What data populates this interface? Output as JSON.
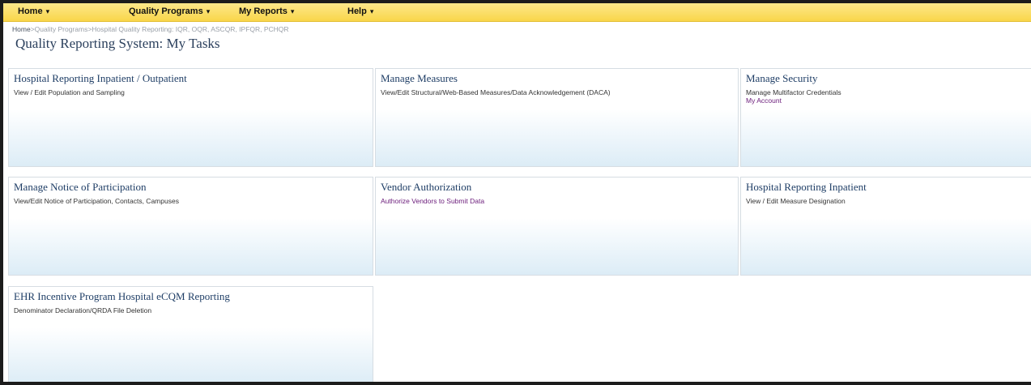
{
  "nav": {
    "items": [
      {
        "label": "Home"
      },
      {
        "label": "Quality Programs"
      },
      {
        "label": "My Reports"
      },
      {
        "label": "Help"
      }
    ],
    "caret_icon": "caret-down-icon"
  },
  "breadcrumb": {
    "home": "Home",
    "separator": ">",
    "programs": "Quality Programs",
    "current": "Hospital Quality Reporting: IQR, OQR, ASCQR, IPFQR, PCHQR"
  },
  "page_title": "Quality Reporting System: My Tasks",
  "tiles": [
    {
      "title": "Hospital Reporting Inpatient / Outpatient",
      "links": [
        {
          "label": "View / Edit Population and Sampling"
        }
      ]
    },
    {
      "title": "Manage Measures",
      "links": [
        {
          "label": "View/Edit Structural/Web-Based Measures/Data Acknowledgement (DACA)"
        }
      ]
    },
    {
      "title": "Manage Security",
      "links": [
        {
          "label": "Manage Multifactor Credentials"
        },
        {
          "label": "My Account"
        }
      ]
    },
    {
      "title": "Manage Notice of Participation",
      "links": [
        {
          "label": "View/Edit Notice of Participation, Contacts, Campuses"
        }
      ]
    },
    {
      "title": "Vendor Authorization",
      "links": [
        {
          "label": "Authorize Vendors to Submit Data"
        }
      ]
    },
    {
      "title": "Hospital Reporting Inpatient",
      "links": [
        {
          "label": "View / Edit Measure Designation"
        }
      ]
    },
    {
      "title": "EHR Incentive Program Hospital eCQM Reporting",
      "links": [
        {
          "label": "Denominator Declaration/QRDA File Deletion"
        }
      ]
    }
  ],
  "colors": {
    "nav_bar": "#f9d64a",
    "title_text": "#2a3f5c",
    "tile_title": "#1f3e66",
    "visited_link": "#6a1b7a",
    "frame_border": "#1c1c1c"
  }
}
